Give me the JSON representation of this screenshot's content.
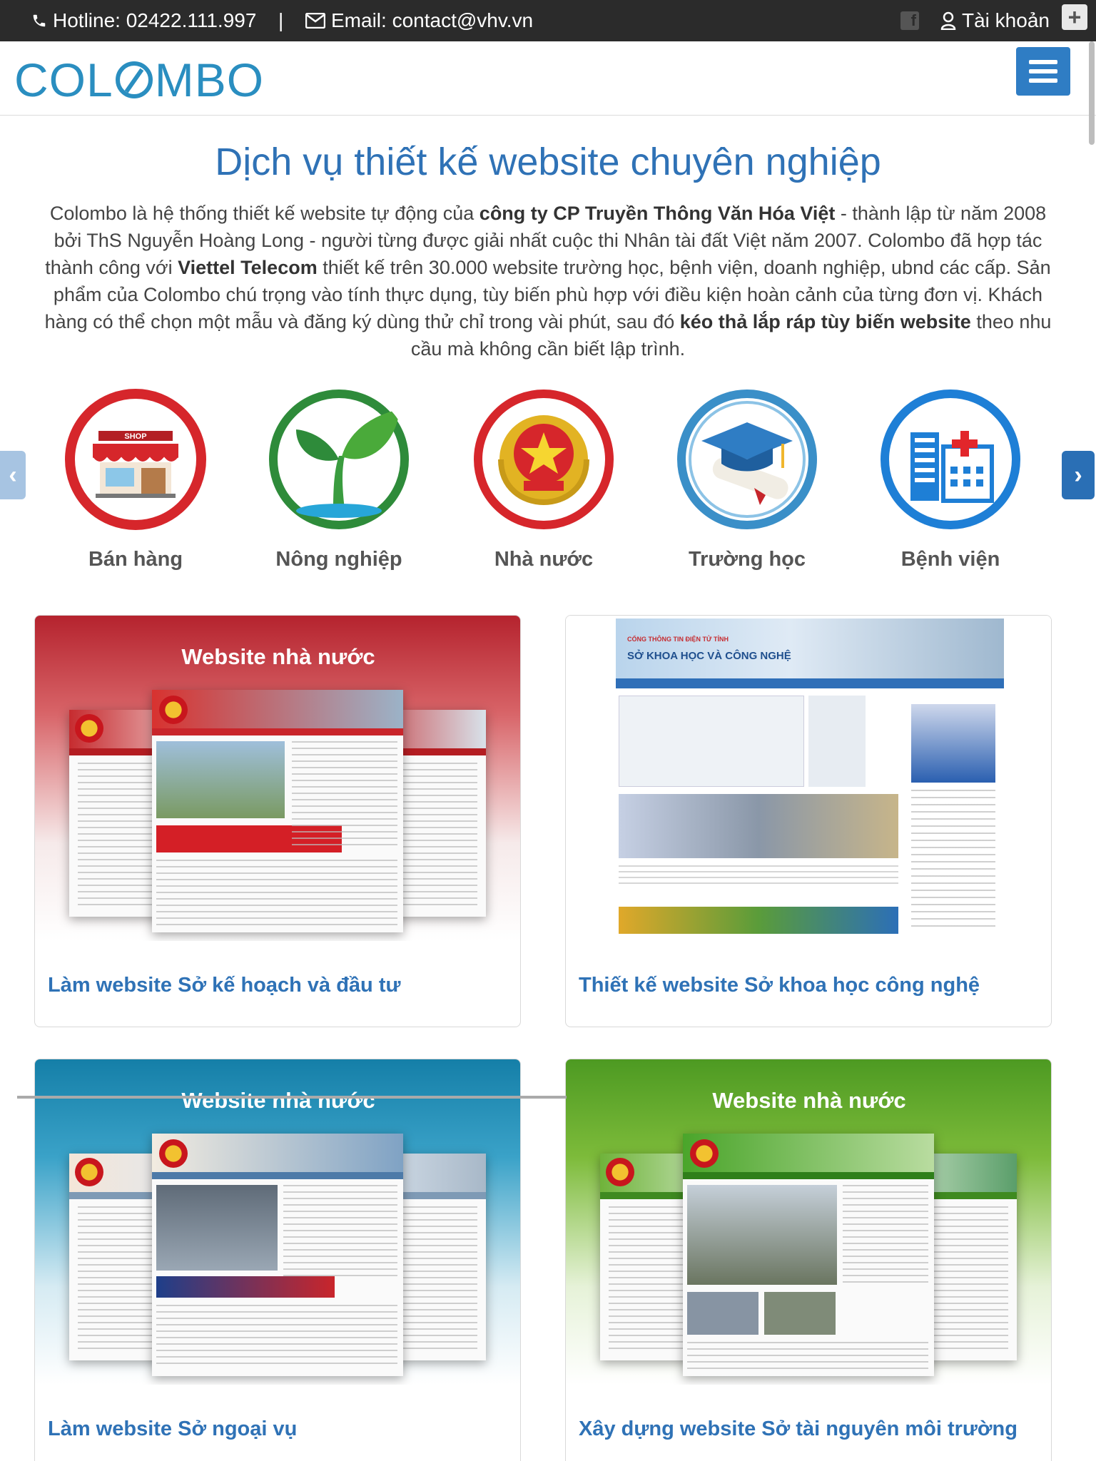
{
  "topbar": {
    "hotline": "Hotline: 02422.111.997",
    "separator": "|",
    "email": "Email: contact@vhv.vn",
    "account": "Tài khoản",
    "plus": "+"
  },
  "header": {
    "logo_left": "COL",
    "logo_right": "MBO"
  },
  "intro": {
    "title": "Dịch vụ thiết kế website chuyên nghiệp",
    "p1": "Colombo là hệ thống thiết kế website tự động của ",
    "company": "công ty CP Truyền Thông Văn Hóa Việt",
    "p2": " - thành lập từ năm 2008 bởi ThS Nguyễn Hoàng Long - người từng được giải nhất cuộc thi Nhân tài đất Việt năm 2007. Colombo đã hợp tác thành công với ",
    "partner": "Viettel Telecom",
    "p3": " thiết kế trên 30.000 website trường học, bệnh viện, doanh nghiệp, ubnd các cấp. Sản phẩm của Colombo chú trọng vào tính thực dụng, tùy biến phù hợp với điều kiện hoàn cảnh của từng đơn vị. Khách hàng có thể chọn một mẫu và đăng ký dùng thử chỉ trong vài phút, sau đó ",
    "highlight": "kéo thả lắp ráp tùy biến website",
    "p4": " theo nhu cầu mà không cần biết lập trình."
  },
  "categories": [
    {
      "label": "Bán hàng",
      "icon": "shop-icon",
      "color": "#d6262b"
    },
    {
      "label": "Nông nghiệp",
      "icon": "sprout-icon",
      "color": "#2e8b3a"
    },
    {
      "label": "Nhà nước",
      "icon": "national-emblem-icon",
      "color": "#d6262b"
    },
    {
      "label": "Trường học",
      "icon": "graduation-cap-icon",
      "color": "#3a8fc8"
    },
    {
      "label": "Bệnh viện",
      "icon": "hospital-icon",
      "color": "#1e7fd6"
    }
  ],
  "cards": [
    {
      "banner_title": "Website nhà nước",
      "caption": "Làm website Sở kế hoạch và đầu tư",
      "theme": "#b5232e"
    },
    {
      "banner_title": "",
      "caption": "Thiết kế website Sở khoa học công nghệ",
      "theme": "#3a78c2"
    },
    {
      "banner_title": "Website nhà nước",
      "caption": "Làm website Sở ngoại vụ",
      "theme": "#1a84b0"
    },
    {
      "banner_title": "Website nhà nước",
      "caption": "Xây dựng website Sở tài nguyên môi trường",
      "theme": "#4d9a22"
    }
  ],
  "screenshot_labels": {
    "card2_org": "CỔNG THÔNG TIN ĐIỆN TỬ TỈNH",
    "card2_dept": "SỞ KHOA HỌC VÀ CÔNG NGHỆ"
  }
}
